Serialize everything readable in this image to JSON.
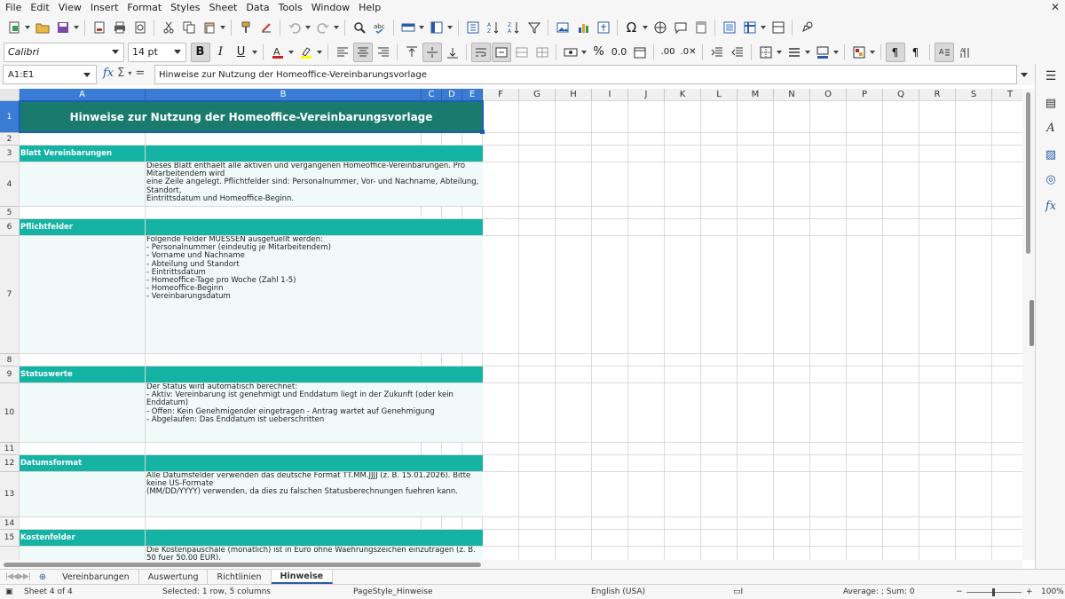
{
  "menu": [
    "File",
    "Edit",
    "View",
    "Insert",
    "Format",
    "Styles",
    "Sheet",
    "Data",
    "Tools",
    "Window",
    "Help"
  ],
  "font_name": "Calibri",
  "font_size": "14 pt",
  "name_box": "A1:E1",
  "formula": "Hinweise zur Nutzung der Homeoffice-Vereinbarungsvorlage",
  "columns": [
    "A",
    "B",
    "C",
    "D",
    "E",
    "F",
    "G",
    "H",
    "I",
    "J",
    "K",
    "L",
    "M",
    "N",
    "O",
    "P",
    "Q",
    "R",
    "S",
    "T"
  ],
  "rows": [
    "1",
    "2",
    "3",
    "4",
    "5",
    "6",
    "7",
    "8",
    "9",
    "10",
    "11",
    "12",
    "13",
    "14",
    "15"
  ],
  "sheet": {
    "title": "Hinweise zur Nutzung der Homeoffice-Vereinbarungsvorlage",
    "sections": [
      {
        "heading": "Blatt Vereinbarungen",
        "text": "Dieses Blatt enthaelt alle aktiven und vergangenen Homeoffice-Vereinbarungen. Pro Mitarbeitendem wird\neine Zeile angelegt. Pflichtfelder sind: Personalnummer, Vor- und Nachname, Abteilung, Standort,\nEintrittsdatum und Homeoffice-Beginn."
      },
      {
        "heading": "Pflichtfelder",
        "text": "Folgende Felder MUESSEN ausgefuellt werden:\n- Personalnummer (eindeutig je Mitarbeitendem)\n- Vorname und Nachname\n- Abteilung und Standort\n- Eintrittsdatum\n- Homeoffice-Tage pro Woche (Zahl 1-5)\n- Homeoffice-Beginn\n- Vereinbarungsdatum"
      },
      {
        "heading": "Statuswerte",
        "text": "Der Status wird automatisch berechnet:\n- Aktiv: Vereinbarung ist genehmigt und Enddatum liegt in der Zukunft (oder kein Enddatum)\n- Offen: Kein Genehmigender eingetragen - Antrag wartet auf Genehmigung\n- Abgelaufen: Das Enddatum ist ueberschritten"
      },
      {
        "heading": "Datumsformat",
        "text": "Alle Datumsfelder verwenden das deutsche Format TT.MM.JJJJ (z. B. 15.01.2026). Bitte keine US-Formate\n(MM/DD/YYYY) verwenden, da dies zu falschen Statusberechnungen fuehren kann."
      },
      {
        "heading": "Kostenfelder",
        "text": "Die Kostenpauschale (monatlich) ist in Euro ohne Waehrungszeichen einzutragen (z. B. 50 fuer 50,00 EUR).\nDas Jahresaequivalent wird automatisch berechnet. Steuerliche Behandlung gemaess geltendem EStG."
      }
    ]
  },
  "tabs": [
    "Vereinbarungen",
    "Auswertung",
    "Richtlinien",
    "Hinweise"
  ],
  "active_tab": "Hinweise",
  "status": {
    "sheet": "Sheet 4 of 4",
    "selection": "Selected: 1 row, 5 columns",
    "page_style": "PageStyle_Hinweise",
    "language": "English (USA)",
    "summary": "Average: ; Sum: 0",
    "zoom": "100%"
  },
  "colors": {
    "title_bg": "#1a7a6e",
    "section_bg": "#14b3a3",
    "body_bg": "#f0fbf9",
    "accent": "#3a7bd5"
  }
}
